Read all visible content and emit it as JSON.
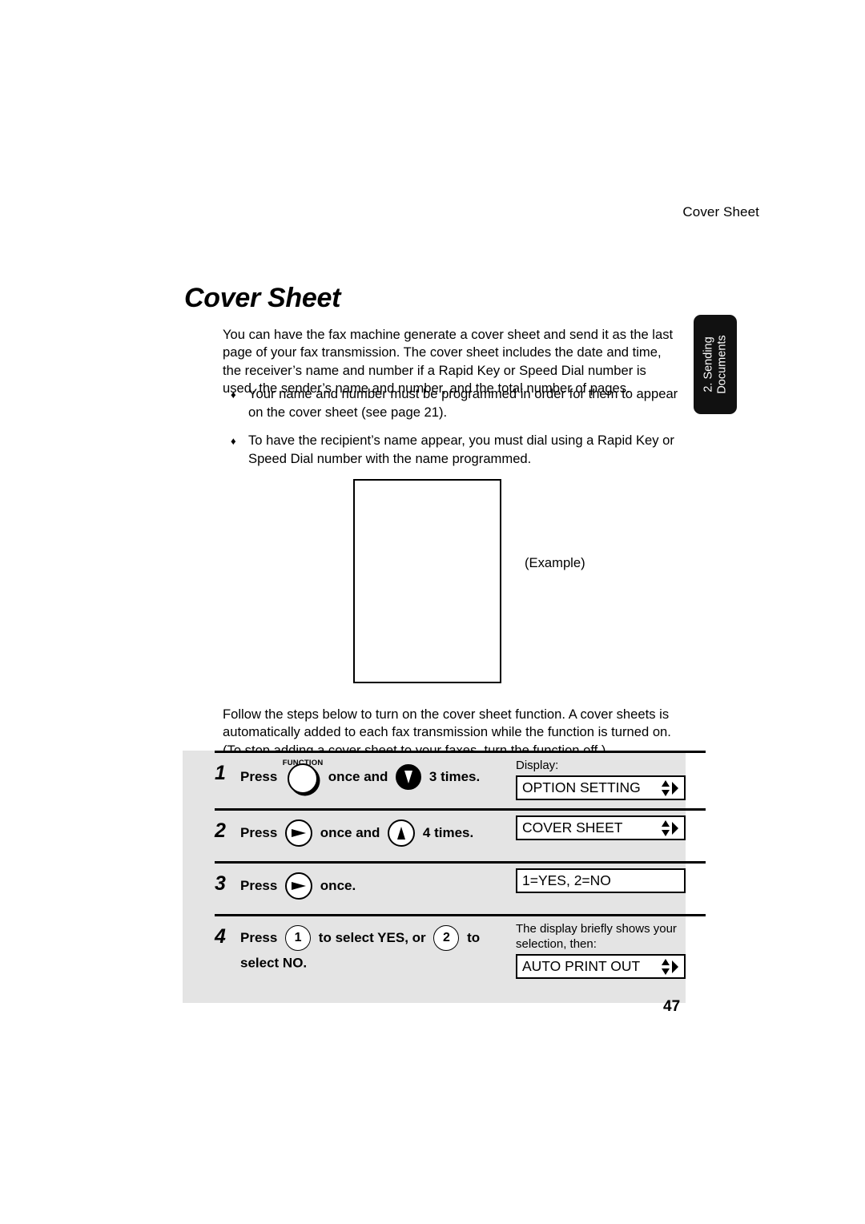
{
  "running_head": "Cover Sheet",
  "page_title": "Cover Sheet",
  "side_tab": {
    "line1": "2. Sending",
    "line2": "Documents"
  },
  "intro_paragraph": "You can have the fax machine generate a cover sheet and send it as the last page of your fax transmission. The cover sheet includes the date and time, the receiver’s name and number if a Rapid Key or Speed Dial number is used, the sender’s name and number, and the total number of pages.",
  "bullets": [
    "Your name and number must be programmed in order for them to appear on the cover sheet (see page 21).",
    "To have the recipient’s name appear, you must dial using a Rapid Key or Speed Dial number with the name programmed."
  ],
  "bullet_glyph": "♦",
  "example_label": "(Example)",
  "follow_paragraph": "Follow the steps below to turn on the cover sheet function. A cover sheets is automatically added to each fax transmission while the function is turned on. (To stop adding a cover sheet to your faxes, turn the function off.)",
  "steps": [
    {
      "number": "1",
      "press_label": "Press",
      "function_key_label": "FUNCTION",
      "middle_text": "once and",
      "tail_text": "3 times.",
      "display_caption": "Display:",
      "display_text": "OPTION SETTING"
    },
    {
      "number": "2",
      "press_label": "Press",
      "middle_text": "once and",
      "tail_text": "4 times.",
      "display_text": "COVER SHEET"
    },
    {
      "number": "3",
      "press_label": "Press",
      "tail_text": "once.",
      "display_text": "1=YES, 2=NO"
    },
    {
      "number": "4",
      "press_label": "Press",
      "key_one": "1",
      "middle_text": "to select YES, or",
      "key_two": "2",
      "tail_text": "to select NO.",
      "display_caption": "The display briefly shows your selection, then:",
      "display_text": "AUTO PRINT OUT"
    }
  ],
  "page_number": "47",
  "colors": {
    "panel_background": "#e4e4e4",
    "side_tab_background": "#111111",
    "ink": "#000000",
    "paper": "#ffffff"
  }
}
